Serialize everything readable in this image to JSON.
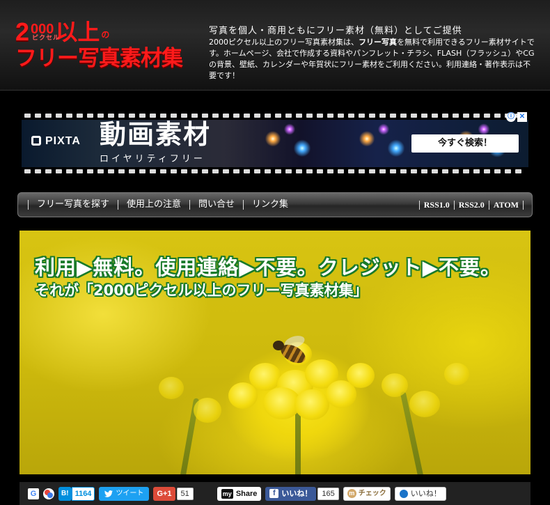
{
  "logo": {
    "digit": "2",
    "zeros": "000",
    "pixel_reading": "ピクセル",
    "ijo": "以上",
    "no": "の",
    "line2": "フリー写真素材集"
  },
  "header": {
    "tagline": "写真を個人・商用ともにフリー素材（無料）としてご提供",
    "description_pre": "2000ピクセル以上のフリー写真素材集は、",
    "description_bold": "フリー写真",
    "description_post": "を無料で利用できるフリー素材サイトです。ホームページ、会社で作成する資料やパンフレット・チラシ、FLASH（フラッシュ）やCGの背景、壁紙、カレンダーや年賀状にフリー素材をご利用ください。利用連絡・著作表示は不要です！"
  },
  "ad": {
    "brand": "PIXTA",
    "title": "動画素材",
    "subtitle": "ロイヤリティフリー",
    "cta": "今すぐ検索！",
    "info_glyph": "ⓘ",
    "close_glyph": "✕"
  },
  "nav": {
    "items": [
      "フリー写真を探す",
      "使用上の注意",
      "問い合せ",
      "リンク集"
    ],
    "feeds": [
      "RSS1.0",
      "RSS2.0",
      "ATOM"
    ]
  },
  "hero": {
    "line1": "利用▶無料。使用連絡▶不要。クレジット▶不要。",
    "line2": "それが「2000ピクセル以上のフリー写真素材集」"
  },
  "social": {
    "google": "G",
    "hatena_label": "B!",
    "hatena_count": "1164",
    "tweet": "ツイート",
    "gplus": "G+1",
    "gplus_count": "51",
    "my_mark": "my",
    "my_label": "Share",
    "facebook_label": "いいね！",
    "facebook_count": "165",
    "mixi_label": "チェック",
    "iine_label": "いいね！"
  },
  "colors": {
    "logo_red": "#ff1a1a",
    "hero_outline": "#1a7a2a",
    "twitter": "#1da1f2",
    "facebook": "#3b5998",
    "hatena": "#008fde",
    "gplus": "#dd4b39"
  }
}
